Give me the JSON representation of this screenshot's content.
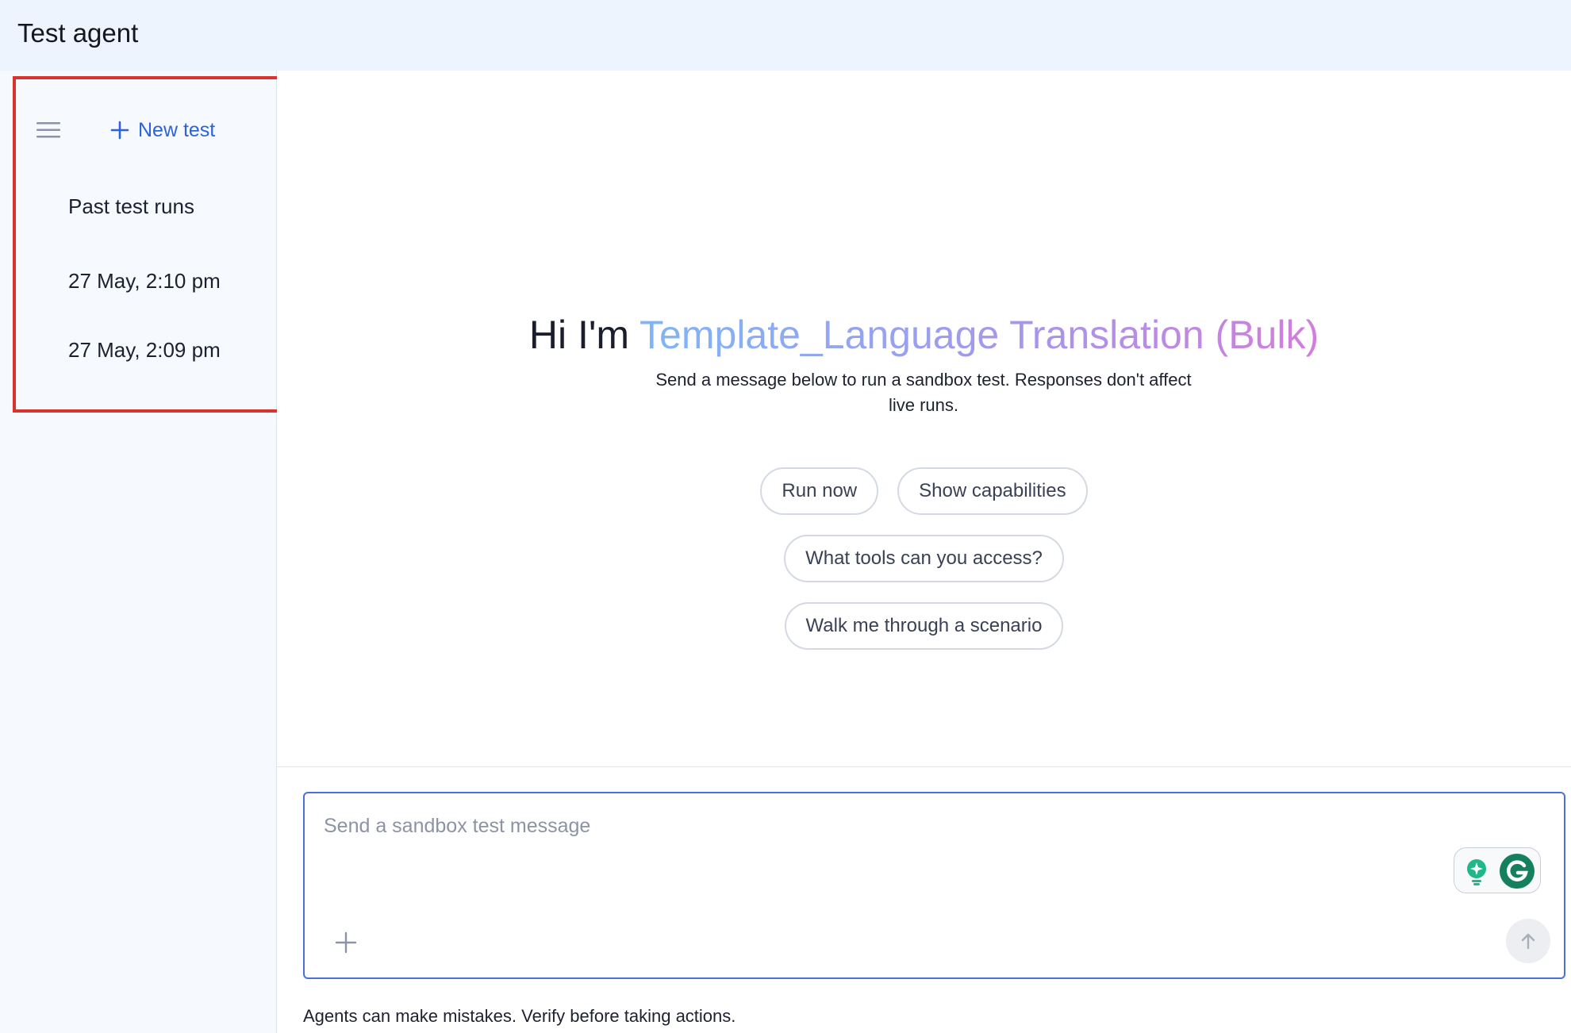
{
  "header": {
    "title": "Test agent"
  },
  "sidebar": {
    "menu_icon": "hamburger-menu-icon",
    "new_test_label": "New test",
    "past_runs_heading": "Past test runs",
    "past_runs": [
      {
        "label": "27 May, 2:10 pm"
      },
      {
        "label": "27 May, 2:09 pm"
      }
    ]
  },
  "main": {
    "greeting_prefix": "Hi I'm ",
    "agent_name": "Template_Language Translation (Bulk)",
    "subtitle": "Send a message below to run a sandbox test. Responses don't affect live runs.",
    "suggestions": [
      {
        "label": "Run now"
      },
      {
        "label": "Show capabilities"
      },
      {
        "label": "What tools can you access?"
      },
      {
        "label": "Walk me through a scenario"
      }
    ]
  },
  "composer": {
    "placeholder": "Send a sandbox test message",
    "value": "",
    "attach_icon": "plus-icon",
    "send_icon": "arrow-up-icon",
    "extension_icon": "grammarly-icon"
  },
  "footer": {
    "disclaimer": "Agents can make mistakes. Verify before taking actions."
  },
  "colors": {
    "accent": "#2b63de",
    "highlight": "#d8332c",
    "header_bg": "#eef4fe",
    "sidebar_bg": "#f6f9fe",
    "composer_border": "#4b6fdf"
  }
}
